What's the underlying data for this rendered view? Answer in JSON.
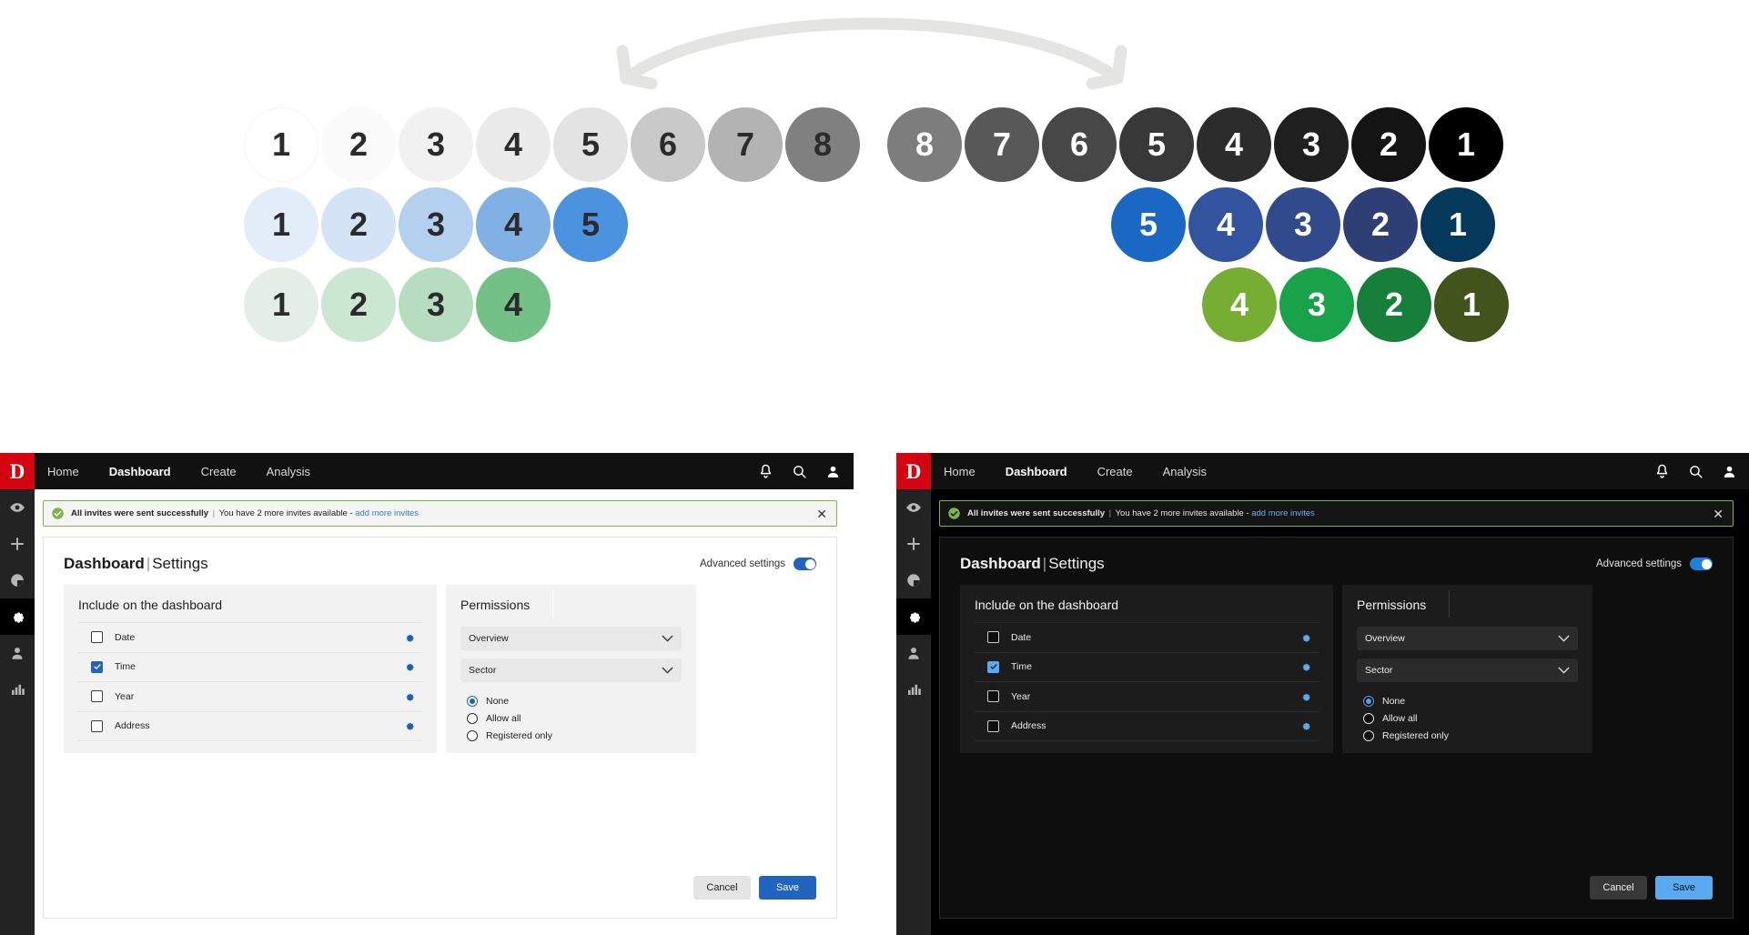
{
  "palette": {
    "arrow_color": "#e4e4e2",
    "rows": [
      {
        "name": "gray-scale-light-to-dark",
        "left": {
          "steps": [
            {
              "label": "1",
              "bg": "#ffffff",
              "fg": "#2b2b2b",
              "border": "#f4f4f4"
            },
            {
              "label": "2",
              "bg": "#fafafa",
              "fg": "#2b2b2b"
            },
            {
              "label": "3",
              "bg": "#f1f1f1",
              "fg": "#2b2b2b"
            },
            {
              "label": "4",
              "bg": "#eaeaea",
              "fg": "#2b2b2b"
            },
            {
              "label": "5",
              "bg": "#e3e3e3",
              "fg": "#2b2b2b"
            },
            {
              "label": "6",
              "bg": "#c9c9c9",
              "fg": "#2b2b2b"
            },
            {
              "label": "7",
              "bg": "#b3b3b3",
              "fg": "#2b2b2b"
            },
            {
              "label": "8",
              "bg": "#808080",
              "fg": "#2b2b2b"
            }
          ]
        },
        "right": {
          "steps": [
            {
              "label": "8",
              "bg": "#7d7d7d",
              "fg": "#ffffff"
            },
            {
              "label": "7",
              "bg": "#585858",
              "fg": "#ffffff"
            },
            {
              "label": "6",
              "bg": "#474747",
              "fg": "#ffffff"
            },
            {
              "label": "5",
              "bg": "#383838",
              "fg": "#ffffff"
            },
            {
              "label": "4",
              "bg": "#2c2c2c",
              "fg": "#ffffff"
            },
            {
              "label": "3",
              "bg": "#1f1f1f",
              "fg": "#ffffff"
            },
            {
              "label": "2",
              "bg": "#141414",
              "fg": "#ffffff"
            },
            {
              "label": "1",
              "bg": "#000000",
              "fg": "#ffffff"
            }
          ]
        }
      },
      {
        "name": "blue-scale-light-to-dark",
        "left": {
          "steps": [
            {
              "label": "1",
              "bg": "#e3edf9",
              "fg": "#2b2b2b"
            },
            {
              "label": "2",
              "bg": "#d4e3f6",
              "fg": "#2b2b2b"
            },
            {
              "label": "3",
              "bg": "#b4d0ef",
              "fg": "#2b2b2b"
            },
            {
              "label": "4",
              "bg": "#81b0e4",
              "fg": "#2b2b2b"
            },
            {
              "label": "5",
              "bg": "#4b93de",
              "fg": "#2b2b2b"
            }
          ]
        },
        "right": {
          "steps": [
            {
              "label": "5",
              "bg": "#1b68c4",
              "fg": "#ffffff"
            },
            {
              "label": "4",
              "bg": "#32549f",
              "fg": "#ffffff"
            },
            {
              "label": "3",
              "bg": "#314a8b",
              "fg": "#ffffff"
            },
            {
              "label": "2",
              "bg": "#2e3f75",
              "fg": "#ffffff"
            },
            {
              "label": "1",
              "bg": "#04395c",
              "fg": "#ffffff"
            }
          ]
        }
      },
      {
        "name": "green-scale-light-to-dark",
        "left": {
          "steps": [
            {
              "label": "1",
              "bg": "#e3efe6",
              "fg": "#2b2b2b"
            },
            {
              "label": "2",
              "bg": "#cbe7d2",
              "fg": "#2b2b2b"
            },
            {
              "label": "3",
              "bg": "#b7ddc0",
              "fg": "#2b2b2b"
            },
            {
              "label": "4",
              "bg": "#74c187",
              "fg": "#2b2b2b"
            }
          ]
        },
        "right": {
          "steps": [
            {
              "label": "4",
              "bg": "#76ae33",
              "fg": "#ffffff"
            },
            {
              "label": "3",
              "bg": "#18a34a",
              "fg": "#ffffff"
            },
            {
              "label": "2",
              "bg": "#16803a",
              "fg": "#ffffff"
            },
            {
              "label": "1",
              "bg": "#42531c",
              "fg": "#ffffff"
            }
          ]
        }
      }
    ]
  },
  "app": {
    "logo_glyph": "D",
    "nav": [
      {
        "label": "Home",
        "active": false
      },
      {
        "label": "Dashboard",
        "active": true
      },
      {
        "label": "Create",
        "active": false
      },
      {
        "label": "Analysis",
        "active": false
      }
    ],
    "topbar_icons": [
      "bell-icon",
      "search-icon",
      "user-icon"
    ],
    "sidebar_icons": [
      {
        "name": "eye-icon",
        "active": false
      },
      {
        "name": "plus-icon",
        "active": false
      },
      {
        "name": "pie-chart-icon",
        "active": false
      },
      {
        "name": "gear-icon",
        "active": true
      },
      {
        "name": "person-icon",
        "active": false
      },
      {
        "name": "bar-chart-icon",
        "active": false
      }
    ],
    "alert": {
      "icon": "check-circle-icon",
      "bold_text": "All invites were sent successfully",
      "separator": "|",
      "message": "You have 2 more invites available -",
      "link": "add more invites",
      "close_label": "✕"
    },
    "page_title_bold": "Dashboard",
    "page_title_separator": "|",
    "page_title_sub": "Settings",
    "advanced_settings_label": "Advanced settings",
    "advanced_settings_on": true,
    "include_panel": {
      "title": "Include on the dashboard",
      "rows": [
        {
          "label": "Date",
          "checked": false,
          "gear": "gear-icon"
        },
        {
          "label": "Time",
          "checked": true,
          "gear": "gear-icon"
        },
        {
          "label": "Year",
          "checked": false,
          "gear": "gear-icon"
        },
        {
          "label": "Address",
          "checked": false,
          "gear": "gear-icon"
        }
      ]
    },
    "permissions_panel": {
      "title": "Permissions",
      "dropdowns": [
        {
          "value": "Overview"
        },
        {
          "value": "Sector"
        }
      ],
      "radios": [
        {
          "label": "None",
          "selected": true
        },
        {
          "label": "Allow all",
          "selected": false
        },
        {
          "label": "Registered only",
          "selected": false
        }
      ]
    },
    "buttons": {
      "cancel": "Cancel",
      "save": "Save"
    },
    "accent_light": "#2064c0",
    "accent_dark": "#5aaaf2",
    "brand_red": "#d40511",
    "alert_green": "#7ab648"
  }
}
